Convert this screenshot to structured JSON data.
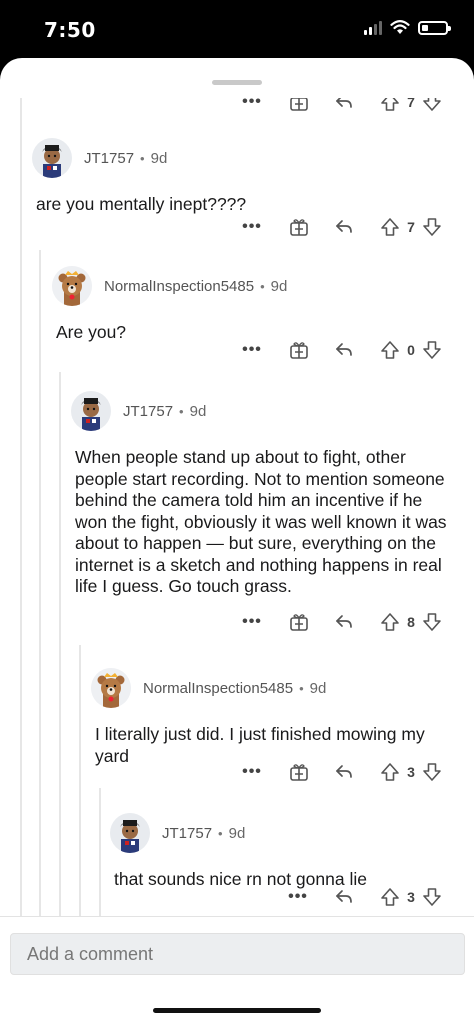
{
  "status_bar": {
    "time": "7:50"
  },
  "comments": [
    {
      "author": "JT1757",
      "age": "9d",
      "text": "are you mentally inept????",
      "score": "7",
      "avatar": "jt-avatar"
    },
    {
      "author": "NormalInspection5485",
      "age": "9d",
      "text": "Are you?",
      "score": "0",
      "avatar": "bear-avatar"
    },
    {
      "author": "JT1757",
      "age": "9d",
      "text": "When people stand up about to fight, other people start recording. Not to mention someone behind the camera told him an incentive if he won the fight, obviously it was well known it was about to happen — but sure, everything on the internet is a sketch and nothing happens in real life I guess. Go touch grass.",
      "score": "8",
      "avatar": "jt-avatar"
    },
    {
      "author": "NormalInspection5485",
      "age": "9d",
      "text": "I literally just did. I just finished mowing my yard",
      "score": "3",
      "avatar": "bear-avatar"
    },
    {
      "author": "JT1757",
      "age": "9d",
      "text": "that sounds nice rn not gonna lie",
      "score": "3",
      "avatar": "jt-avatar"
    }
  ],
  "partial_top": {
    "score": "7"
  },
  "common": {
    "separator": "•",
    "more": "•••"
  },
  "composer": {
    "placeholder": "Add a comment"
  }
}
